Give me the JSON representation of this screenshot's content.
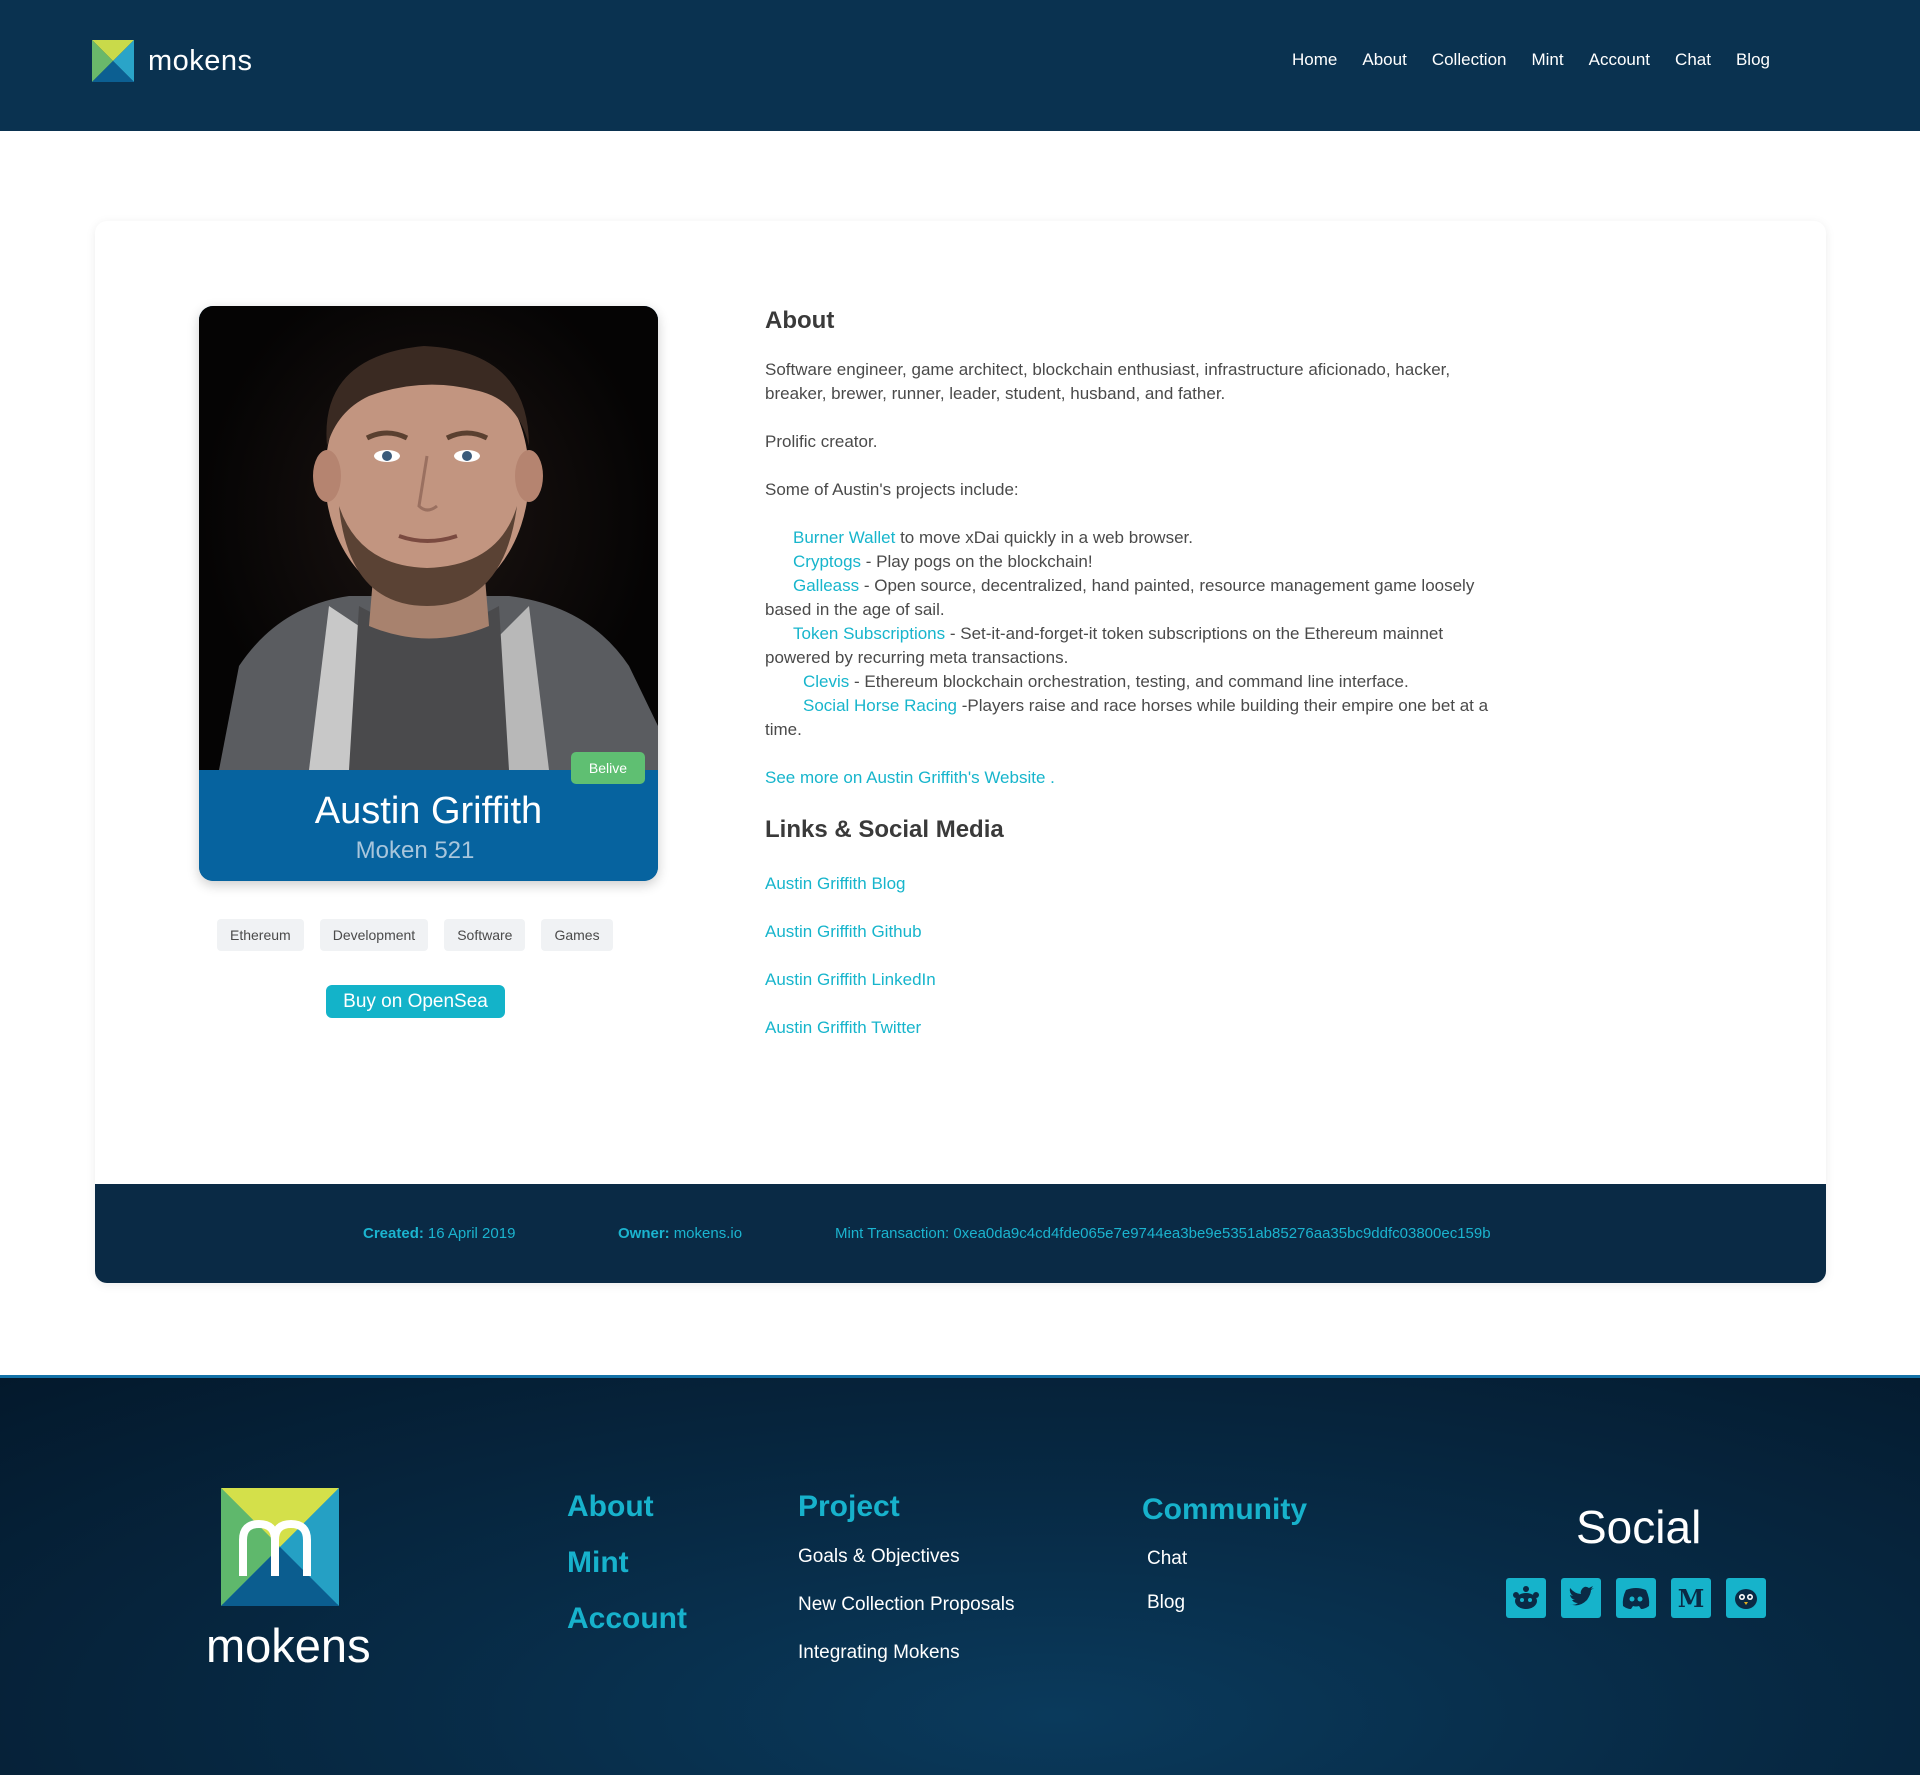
{
  "header": {
    "brand": "mokens",
    "nav": [
      "Home",
      "About",
      "Collection",
      "Mint",
      "Account",
      "Chat",
      "Blog"
    ]
  },
  "moken": {
    "name": "Austin Griffith",
    "number": "Moken 521",
    "badge": "Belive",
    "tags": [
      "Ethereum",
      "Development",
      "Software",
      "Games"
    ],
    "buy_label": "Buy on OpenSea"
  },
  "about": {
    "heading": "About",
    "intro_line1": "Software engineer, game architect, blockchain enthusiast, infrastructure aficionado, hacker,",
    "intro_line2": "breaker, brewer, runner, leader, student, husband, and father.",
    "prolific": "Prolific creator.",
    "projects_intro": "Some of Austin's projects include:",
    "projects": [
      {
        "name": "Burner Wallet",
        "desc": " to move xDai quickly in a web browser."
      },
      {
        "name": "Cryptogs",
        "desc": " - Play pogs on the blockchain!"
      },
      {
        "name": "Galleass",
        "desc": " - Open source, decentralized, hand painted, resource management game loosely",
        "desc2": "based in the age of sail."
      },
      {
        "name": "Token Subscriptions",
        "desc": " - Set-it-and-forget-it token subscriptions on the Ethereum mainnet",
        "desc2": "powered by recurring meta transactions."
      },
      {
        "name": "Clevis",
        "desc": " - Ethereum blockchain orchestration, testing, and command line interface."
      },
      {
        "name": "Social Horse Racing",
        "desc": " -Players raise and race horses while building their empire one bet at a",
        "desc2": "time."
      }
    ],
    "see_more": "See more on Austin Griffith's Website ."
  },
  "links": {
    "heading": "Links & Social Media",
    "items": [
      "Austin Griffith Blog",
      "Austin Griffith Github",
      "Austin Griffith LinkedIn",
      "Austin Griffith Twitter"
    ]
  },
  "meta": {
    "created_label": "Created:",
    "created_value": "16 April 2019",
    "owner_label": "Owner:",
    "owner_value": "mokens.io",
    "mint_tx": "Mint Transaction: 0xea0da9c4cd4fde065e7e9744ea3be9e5351ab85276aa35bc9ddfc03800ec159b"
  },
  "footer": {
    "brand": "mokens",
    "col1": [
      "About",
      "Mint",
      "Account"
    ],
    "project_heading": "Project",
    "project_items": [
      "Goals & Objectives",
      "New Collection Proposals",
      "Integrating Mokens"
    ],
    "community_heading": "Community",
    "community_items": [
      "Chat",
      "Blog"
    ],
    "social_heading": "Social",
    "social_icons": [
      "reddit-icon",
      "twitter-icon",
      "discord-icon",
      "medium-icon",
      "mastodon-icon"
    ]
  },
  "colors": {
    "header_bg": "#0a3250",
    "accent": "#17b5cc",
    "nameplate": "#06639f",
    "badge": "#5fbf72"
  }
}
